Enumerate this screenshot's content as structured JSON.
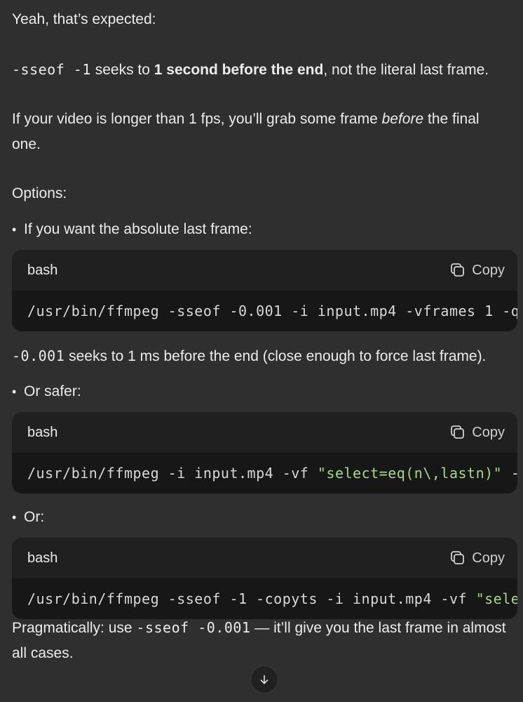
{
  "message": {
    "intro": "Yeah, that’s expected:",
    "sseof_line": {
      "code": "-sseof -1",
      "text_before_bold": " seeks to ",
      "bold": "1 second before the end",
      "text_after": ", not the literal last frame."
    },
    "longer_para": {
      "before": "If your video is longer than 1 fps, you’ll grab some frame ",
      "italic": "before",
      "after": " the final one."
    },
    "options_heading": "Options:",
    "bullets": [
      {
        "text": "If you want the absolute last frame:"
      },
      {
        "text": "Or safer:"
      },
      {
        "text": "Or:"
      }
    ],
    "code_blocks": [
      {
        "lang": "bash",
        "copy_label": "Copy",
        "code_plain": "/usr/bin/ffmpeg -sseof -0.001 -i input.mp4 -vframes 1 -q",
        "code_string": "",
        "code_tail": ""
      },
      {
        "lang": "bash",
        "copy_label": "Copy",
        "code_plain": "/usr/bin/ffmpeg -i input.mp4 -vf ",
        "code_string": "\"select=eq(n\\,lastn)\"",
        "code_tail": " -"
      },
      {
        "lang": "bash",
        "copy_label": "Copy",
        "code_plain": "/usr/bin/ffmpeg -sseof -1 -copyts -i input.mp4 -vf ",
        "code_string": "\"sele",
        "code_tail": ""
      }
    ],
    "ms_line": {
      "code": "-0.001",
      "text": " seeks to 1 ms before the end (close enough to force last frame)."
    },
    "pragmatic": {
      "before": "Pragmatically: use ",
      "code": "-sseof -0.001",
      "after": " — it’ll give you the last frame in almost all cases."
    }
  },
  "scroll_button": {
    "icon": "arrow-down-icon"
  }
}
